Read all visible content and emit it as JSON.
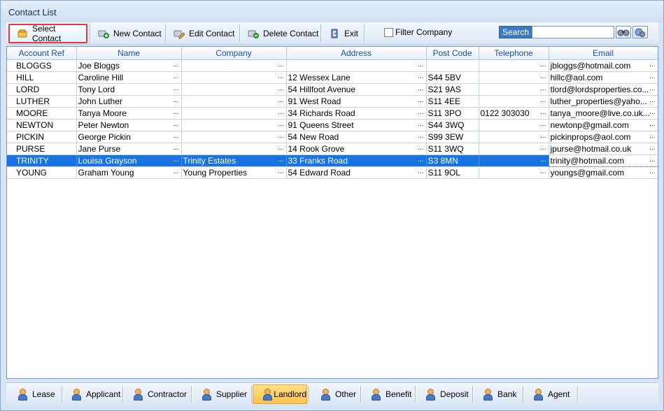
{
  "window": {
    "title": "Contact List"
  },
  "toolbar": {
    "buttons": [
      {
        "label": "Select Contact",
        "icon": "select-contact-icon"
      },
      {
        "label": "New Contact",
        "icon": "new-contact-icon"
      },
      {
        "label": "Edit Contact",
        "icon": "edit-contact-icon"
      },
      {
        "label": "Delete Contact",
        "icon": "delete-contact-icon"
      },
      {
        "label": "Exit",
        "icon": "exit-icon"
      }
    ],
    "filter_label": "Filter Company",
    "filter_checked": false,
    "search_label": "Search",
    "search_value": ""
  },
  "grid": {
    "columns": [
      "Account Ref",
      "Name",
      "Company",
      "Address",
      "Post Code",
      "Telephone",
      "Email"
    ],
    "rows": [
      [
        "BLOGGS",
        "Joe Bloggs",
        "",
        "",
        "",
        "",
        "jbloggs@hotmail.com"
      ],
      [
        "HILL",
        "Caroline Hill",
        "",
        "12 Wessex Lane",
        "S44 5BV",
        "",
        "hillc@aol.com"
      ],
      [
        "LORD",
        "Tony Lord",
        "",
        "54 Hillfoot Avenue",
        "S21 9AS",
        "",
        "tlord@lordsproperties.co..."
      ],
      [
        "LUTHER",
        "John Luther",
        "",
        "91 West Road",
        "S11 4EE",
        "",
        "luther_properties@yaho..."
      ],
      [
        "MOORE",
        "Tanya Moore",
        "",
        "34 Richards Road",
        "S11 3PO",
        "0122 303030",
        "tanya_moore@live.co.uk..."
      ],
      [
        "NEWTON",
        "Peter Newton",
        "",
        "91 Queens Street",
        "S44 3WQ",
        "",
        "newtonp@gmail.com"
      ],
      [
        "PICKIN",
        "George Pickin",
        "",
        "54 New Road",
        "S99 3EW",
        "",
        "pickinprops@aol.com"
      ],
      [
        "PURSE",
        "Jane Purse",
        "",
        "14 Rook Grove",
        "S11 3WQ",
        "",
        "jpurse@hotmail.co.uk"
      ],
      [
        "TRINITY",
        "Louisa Grayson",
        "Trinity Estates",
        "33 Franks Road",
        "S3 8MN",
        "",
        "trinity@hotmail.com"
      ],
      [
        "YOUNG",
        "Graham Young",
        "Young Properties",
        "54 Edward Road",
        "S11 9OL",
        "",
        "youngs@gmail.com"
      ]
    ],
    "selected_row": 8,
    "ellipsis": "..."
  },
  "bottom_tabs": [
    {
      "label": "Lease",
      "active": false
    },
    {
      "label": "Applicant",
      "active": false
    },
    {
      "label": "Contractor",
      "active": false
    },
    {
      "label": "Supplier",
      "active": false
    },
    {
      "label": "Landlord",
      "active": true
    },
    {
      "label": "Other",
      "active": false
    },
    {
      "label": "Benefit",
      "active": false
    },
    {
      "label": "Deposit",
      "active": false
    },
    {
      "label": "Bank",
      "active": false
    },
    {
      "label": "Agent",
      "active": false
    }
  ],
  "colors": {
    "selection": "#1874e3",
    "header_text": "#1c4f9c",
    "active_tab": "#ffc24a",
    "highlight_border": "#e0393e"
  }
}
